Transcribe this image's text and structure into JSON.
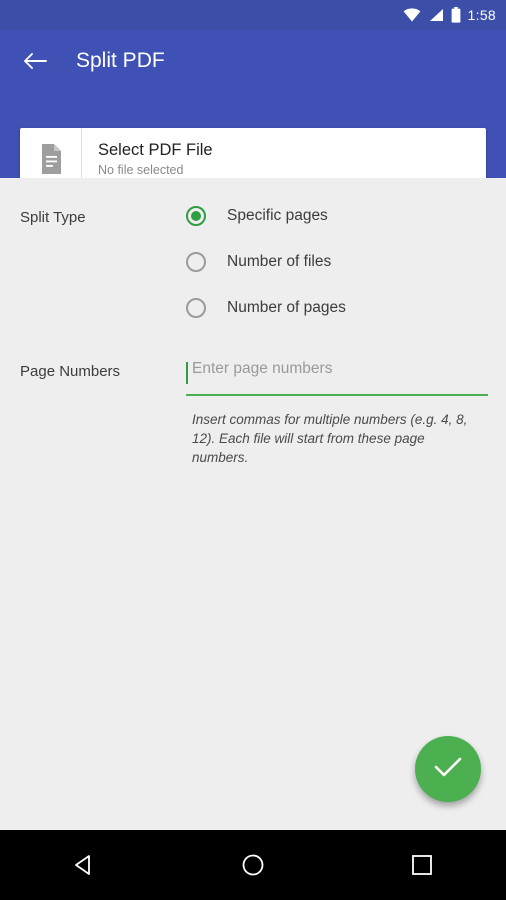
{
  "status_bar": {
    "time": "1:58",
    "icons": [
      "wifi-icon",
      "signal-icon",
      "battery-icon"
    ]
  },
  "app_bar": {
    "back_icon": "back-arrow-icon",
    "title": "Split PDF"
  },
  "file_selector": {
    "icon": "document-icon",
    "title": "Select PDF File",
    "subtitle": "No file selected"
  },
  "form": {
    "split_type_label": "Split Type",
    "options": [
      {
        "label": "Specific pages",
        "selected": true
      },
      {
        "label": "Number of files",
        "selected": false
      },
      {
        "label": "Number of pages",
        "selected": false
      }
    ],
    "page_numbers_label": "Page Numbers",
    "page_numbers_value": "",
    "page_numbers_placeholder": "Enter page numbers",
    "helper_text": "Insert commas for multiple numbers (e.g. 4, 8, 12). Each file will start from these page numbers."
  },
  "fab": {
    "icon": "check-icon",
    "color": "#4caf50"
  },
  "nav_bar": {
    "back": "triangle-back-icon",
    "home": "circle-home-icon",
    "recents": "square-recents-icon"
  },
  "colors": {
    "primary": "#3f51b5",
    "status": "#3b4fa8",
    "accent": "#4caf50",
    "background": "#eeeeee"
  }
}
